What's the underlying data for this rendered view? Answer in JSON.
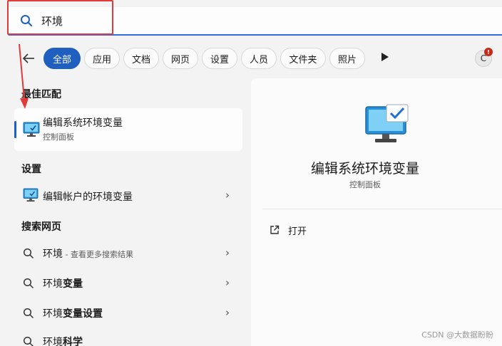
{
  "search": {
    "query": "环境"
  },
  "filters": [
    "全部",
    "应用",
    "文档",
    "网页",
    "设置",
    "人员",
    "文件夹",
    "照片"
  ],
  "account": {
    "initial": "C",
    "badge": "!"
  },
  "sections": {
    "best_match": "最佳匹配",
    "settings": "设置",
    "web": "搜索网页"
  },
  "best_match": {
    "title": "编辑系统环境变量",
    "subtitle": "控制面板"
  },
  "settings_item": {
    "title": "编辑帐户的环境变量"
  },
  "web_results": [
    {
      "prefix": "环境",
      "bold": "",
      "hint": " - 查看更多搜索结果"
    },
    {
      "prefix": "环境",
      "bold": "变量",
      "hint": ""
    },
    {
      "prefix": "环境",
      "bold": "变量设置",
      "hint": ""
    },
    {
      "prefix": "环境",
      "bold": "科学",
      "hint": ""
    }
  ],
  "detail": {
    "title": "编辑系统环境变量",
    "subtitle": "控制面板",
    "open_label": "打开"
  },
  "watermark": "CSDN @大数据盼盼",
  "colors": {
    "accent": "#1f5fbf",
    "annotation_red": "#e23a3a",
    "search_underline": "#2f6fdc"
  }
}
